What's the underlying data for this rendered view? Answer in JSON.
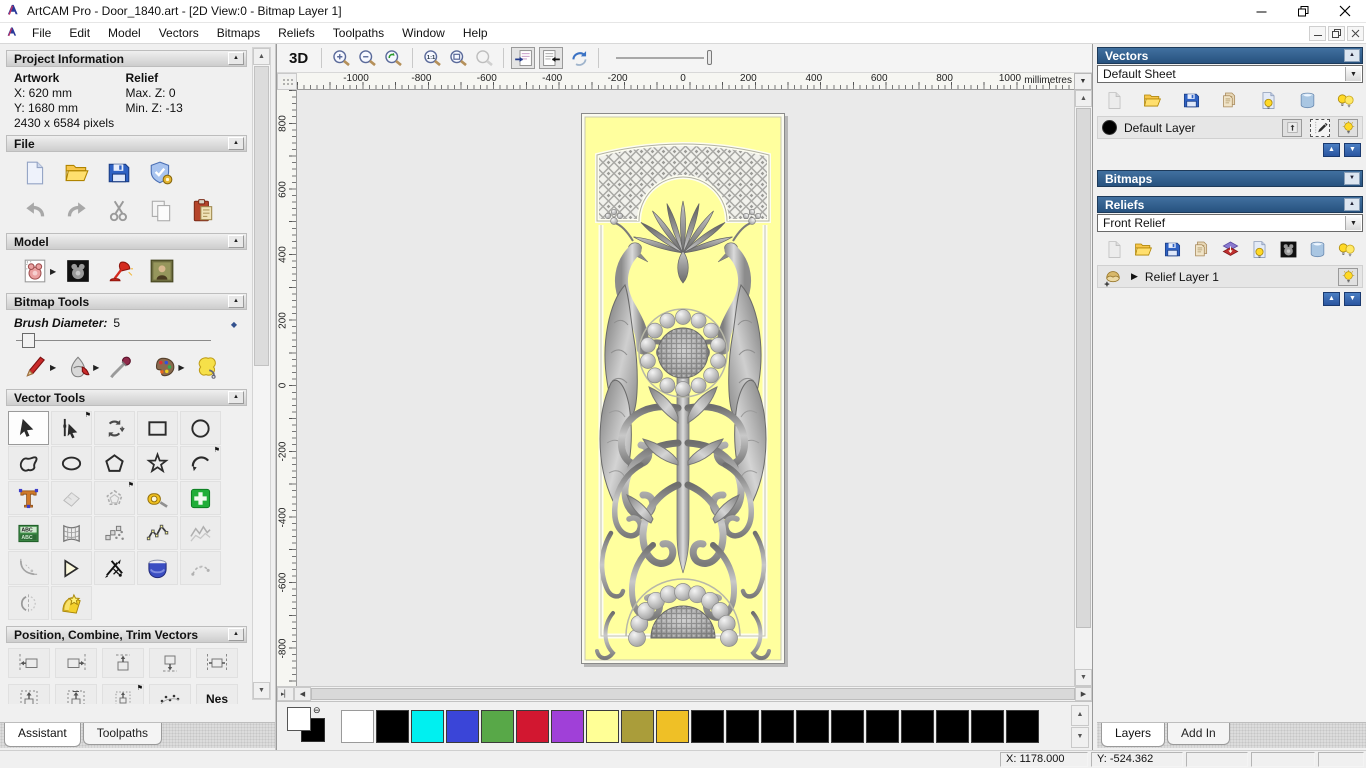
{
  "window": {
    "title": "ArtCAM Pro - Door_1840.art - [2D View:0 - Bitmap Layer 1]",
    "menus": [
      "File",
      "Edit",
      "Model",
      "Vectors",
      "Bitmaps",
      "Reliefs",
      "Toolpaths",
      "Window",
      "Help"
    ]
  },
  "assistant": {
    "project_information": {
      "title": "Project Information",
      "artwork_label": "Artwork",
      "relief_label": "Relief",
      "artwork_x": "X: 620 mm",
      "artwork_y": "Y: 1680 mm",
      "relief_max": "Max. Z: 0",
      "relief_min": "Min. Z: -13",
      "pixels": "2430 x 6584 pixels"
    },
    "file_section": {
      "title": "File",
      "icons_row1": [
        "new-file",
        "open-file",
        "save-file",
        "model-check"
      ],
      "icons_row2": [
        "undo",
        "redo",
        "cut",
        "copy",
        "paste"
      ]
    },
    "model_section": {
      "title": "Model",
      "icons": [
        "model-dimensions",
        "relief-preview",
        "lighting",
        "load-image"
      ]
    },
    "bitmap_tools": {
      "title": "Bitmap Tools",
      "brush_label": "Brush Diameter:",
      "brush_value": "5",
      "icons": [
        "paint-brush",
        "flood-fill",
        "colour-picker",
        "colour-palette",
        "texture-relief"
      ]
    },
    "vector_tools": {
      "title": "Vector Tools",
      "tools": [
        "select",
        "node-edit",
        "transform",
        "create-rectangle",
        "create-circle",
        "create-freehand",
        "create-ellipse",
        "create-polygon",
        "create-star",
        "create-arc",
        "create-text",
        "block-copy-gray",
        "offset-gray",
        "measure",
        "doctor-vector",
        "text-panel",
        "envelope-distort",
        "paste-along-curve",
        "fit-arcs",
        "simplify-gray",
        "fillet-gray",
        "chamfer",
        "trim-vectors",
        "extrude",
        "blend-gray",
        "mirror-gray",
        "wrap-vectors"
      ]
    },
    "position_section": {
      "title": "Position, Combine, Trim Vectors",
      "row1": [
        "align-left",
        "align-right",
        "align-top",
        "align-bottom",
        "align-centre-x"
      ],
      "row2": [
        "centre-top",
        "centre-boxed",
        "centre-pin",
        "scatter",
        "nest"
      ],
      "nest_label": "Nes"
    },
    "tabs": [
      {
        "label": "Assistant",
        "active": true
      },
      {
        "label": "Toolpaths",
        "active": false
      }
    ]
  },
  "canvas": {
    "toolbar": {
      "view_3d": "3D",
      "zoom_group1": [
        "zoom-in",
        "zoom-out",
        "zoom-previous"
      ],
      "zoom_group2": [
        "zoom-11",
        "zoom-fit",
        "zoom-object-gray"
      ],
      "toggles": [
        "toggle-bitmap",
        "toggle-vector"
      ],
      "extra": [
        "flip-view"
      ]
    },
    "ruler": {
      "h_labels": [
        "-1000",
        "-800",
        "-600",
        "-400",
        "-200",
        "0",
        "200",
        "400",
        "600",
        "800",
        "1000"
      ],
      "v_labels": [
        "800",
        "600",
        "400",
        "200",
        "0",
        "-200",
        "-400",
        "-600",
        "-800"
      ],
      "units": "millimetres"
    }
  },
  "panels": {
    "vectors": {
      "title": "Vectors",
      "sheet": "Default Sheet",
      "icons": [
        "new-gray",
        "open-file",
        "save-file",
        "import-stack",
        "bulb-page",
        "eraser-trash",
        "bulbs-all"
      ],
      "layer": {
        "name": "Default Layer",
        "swatch": "#000000",
        "buttons": [
          "merge-up",
          "edit-pen",
          "bulb-on"
        ]
      }
    },
    "bitmaps": {
      "title": "Bitmaps"
    },
    "reliefs": {
      "title": "Reliefs",
      "relief": "Front Relief",
      "icons": [
        "new-gray",
        "open-file",
        "save-file",
        "import-stack",
        "layer-stack",
        "bulb-page",
        "relief-preview",
        "eraser-trash",
        "bulbs-all"
      ],
      "layer": {
        "name": "Relief Layer 1",
        "buttons": [
          "bulb-on"
        ]
      }
    },
    "tabs": [
      {
        "label": "Layers",
        "active": true
      },
      {
        "label": "Add In",
        "active": false
      }
    ]
  },
  "palette": {
    "primary": "#ffffff",
    "secondary": "#000000",
    "swatches": [
      "#ffffff",
      "#000000",
      "#00f0f0",
      "#3a45d8",
      "#58a848",
      "#d21730",
      "#a040d8",
      "#ffff96",
      "#aa9d3a",
      "#efc026",
      "#000000",
      "#000000",
      "#000000",
      "#000000",
      "#000000",
      "#000000",
      "#000000",
      "#000000",
      "#000000",
      "#000000"
    ]
  },
  "status": {
    "x": "X: 1178.000",
    "y": "Y: -524.362"
  },
  "artwork_colors": {
    "background_yellow": "#ffff9e",
    "relief_gray_dark": "#6a6a6a",
    "relief_gray_light": "#d8d8d8"
  }
}
